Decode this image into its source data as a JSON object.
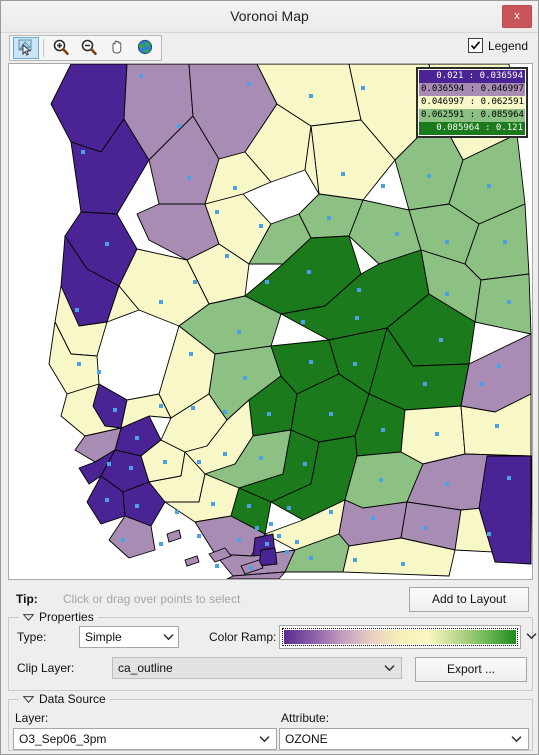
{
  "window": {
    "title": "Voronoi Map",
    "close_label": "x"
  },
  "toolbar": {
    "buttons": [
      {
        "name": "select-tool",
        "icon": "select-arrow-icon",
        "active": true
      },
      {
        "name": "zoom-in-tool",
        "icon": "zoom-in-icon",
        "active": false
      },
      {
        "name": "zoom-out-tool",
        "icon": "zoom-out-icon",
        "active": false
      },
      {
        "name": "pan-tool",
        "icon": "pan-hand-icon",
        "active": false
      },
      {
        "name": "full-extent-tool",
        "icon": "globe-icon",
        "active": false
      }
    ],
    "legend_checkbox": {
      "label": "Legend",
      "checked": true
    }
  },
  "map_legend": {
    "classes": [
      {
        "label": "0.021 : 0.036594",
        "color": "#4a2394",
        "text_color": "#ffffff"
      },
      {
        "label": "0.036594 : 0.046997",
        "color": "#a88cb4",
        "text_color": "#000000"
      },
      {
        "label": "0.046997 : 0.062591",
        "color": "#f7f7c8",
        "text_color": "#000000"
      },
      {
        "label": "0.062591 : 0.085964",
        "color": "#8cc183",
        "text_color": "#000000"
      },
      {
        "label": "0.085964 : 0.121",
        "color": "#1b7a1b",
        "text_color": "#ffffff"
      }
    ]
  },
  "map": {
    "point_color": "#4aa3e8",
    "outline_color": "#000000",
    "background": "#ffffff"
  },
  "tip": {
    "label": "Tip:",
    "text": "Click or drag over points to select"
  },
  "buttons": {
    "add_to_layout": "Add to Layout",
    "export": "Export ..."
  },
  "properties": {
    "title": "Properties",
    "type_label": "Type:",
    "type_value": "Simple",
    "type_options": [
      "Simple"
    ],
    "color_ramp_label": "Color Ramp:",
    "color_ramp_stops": [
      "#5b2d91",
      "#8b5ea8",
      "#c39bbf",
      "#e8cfc4",
      "#f6f0b8",
      "#f9f7c0",
      "#b9d68c",
      "#6db857",
      "#1f8a1f"
    ],
    "clip_layer_label": "Clip Layer:",
    "clip_layer_value": "ca_outline",
    "clip_layer_options": [
      "ca_outline"
    ]
  },
  "data_source": {
    "title": "Data Source",
    "layer_label": "Layer:",
    "layer_value": "O3_Sep06_3pm",
    "layer_options": [
      "O3_Sep06_3pm"
    ],
    "attribute_label": "Attribute:",
    "attribute_value": "OZONE",
    "attribute_options": [
      "OZONE"
    ]
  }
}
